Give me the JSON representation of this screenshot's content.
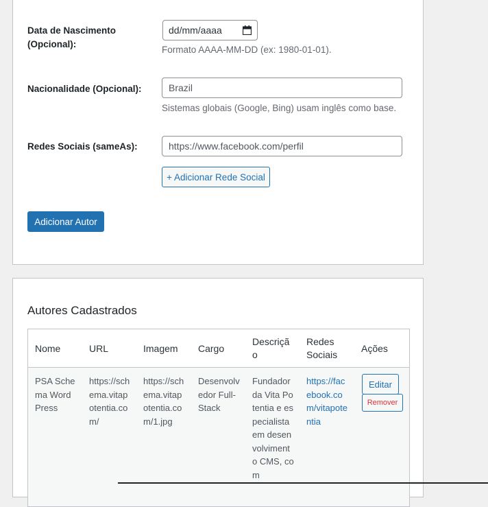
{
  "form": {
    "birth_date": {
      "label": "Data de Nascimento (Opcional):",
      "value": "dd/mm/aaaa",
      "icon": "calendar-icon",
      "help": "Formato AAAA-MM-DD (ex: 1980-01-01)."
    },
    "nationality": {
      "label": "Nacionalidade (Opcional):",
      "placeholder": "Brazil",
      "help": "Sistemas globais (Google, Bing) usam inglês como base."
    },
    "social": {
      "label": "Redes Sociais (sameAs):",
      "placeholder": "https://www.facebook.com/perfil",
      "add_button": "+ Adicionar Rede Social"
    },
    "submit_button": "Adicionar Autor"
  },
  "authors": {
    "title": "Autores Cadastrados",
    "columns": [
      "Nome",
      "URL",
      "Imagem",
      "Cargo",
      "Descrição",
      "Redes Sociais",
      "Ações"
    ],
    "rows": [
      {
        "name": "PSA Schema WordPress",
        "url": "https://schema.vitapotentia.com/",
        "image": "https://schema.vitapotentia.com/1.jpg",
        "role": "Desenvolvedor Full-Stack",
        "description": "Fundador da Vita Potentia e especialista em desenvolvimento CMS, com",
        "social": "https://facebook.com/vitapotentia",
        "edit_label": "Editar",
        "remove_label": "Remover"
      }
    ]
  },
  "colors": {
    "accent": "#2271b1",
    "danger": "#d63638",
    "background": "#f0f0f1"
  }
}
